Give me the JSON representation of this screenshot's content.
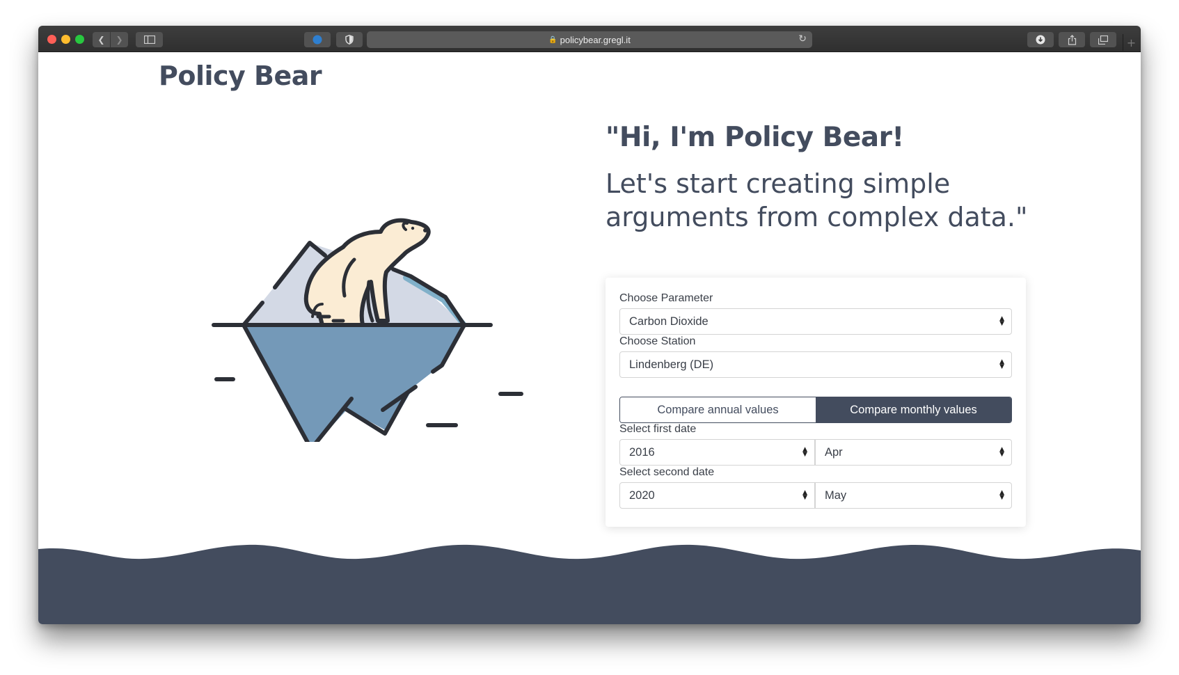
{
  "browser": {
    "url": "policybear.gregl.it"
  },
  "page": {
    "brand": "Policy Bear",
    "headline": "\"Hi, I'm Policy Bear!",
    "subline": "Let's start creating simple arguments from complex data.\""
  },
  "form": {
    "parameter_label": "Choose Parameter",
    "parameter_value": "Carbon Dioxide",
    "station_label": "Choose Station",
    "station_value": "Lindenberg (DE)",
    "compare_annual_label": "Compare annual values",
    "compare_monthly_label": "Compare monthly values",
    "active_mode": "monthly",
    "first_date_label": "Select first date",
    "first_year": "2016",
    "first_month": "Apr",
    "second_date_label": "Select second date",
    "second_year": "2020",
    "second_month": "May"
  },
  "colors": {
    "navy": "#434c5e",
    "ice_top": "#d3d9e5",
    "ice_bottom": "#7499b8",
    "ice_highlight": "#80b0c9",
    "bear_fur": "#fbecd4",
    "outline": "#2c2f36"
  },
  "icons": {
    "nav_back": "chevron-left-icon",
    "nav_forward": "chevron-right-icon",
    "sidebar": "sidebar-icon",
    "lock": "lock-icon",
    "reload": "reload-icon",
    "download": "download-icon",
    "share": "share-icon",
    "tabs": "tabs-icon",
    "select_caret": "updown-caret-icon"
  }
}
